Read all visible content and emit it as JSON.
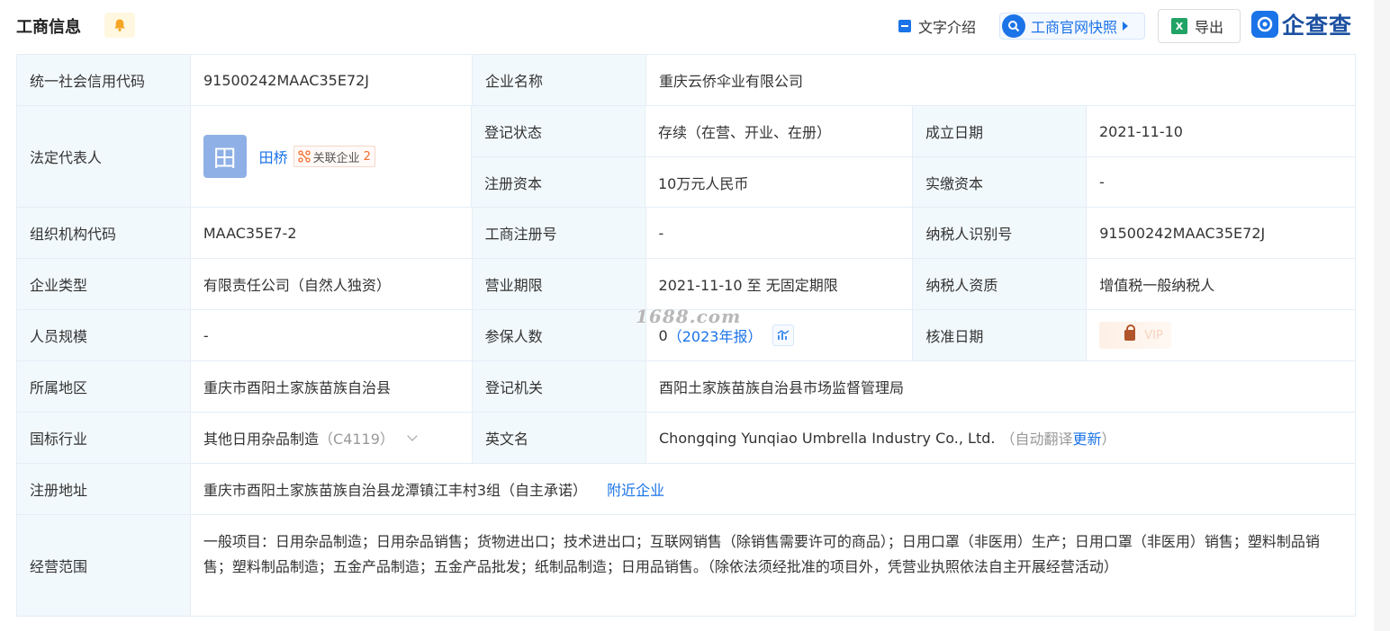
{
  "header": {
    "title": "工商信息",
    "text_intro": "文字介绍",
    "snapshot": "工商官网快照",
    "export": "导出",
    "export_icon_letter": "X",
    "logo_text": "企查查",
    "icons": [
      "bell-icon",
      "doc-icon",
      "search-icon",
      "excel-icon",
      "qcc-logo-icon"
    ]
  },
  "info": {
    "credit_code_label": "统一社会信用代码",
    "credit_code": "91500242MAAC35E72J",
    "company_name_label": "企业名称",
    "company_name": "重庆云侨伞业有限公司",
    "legal_rep_label": "法定代表人",
    "legal_rep_avatar": "田",
    "legal_rep": "田桥",
    "related_label": "关联企业",
    "related_count": "2",
    "status_label": "登记状态",
    "status": "存续（在营、开业、在册）",
    "est_date_label": "成立日期",
    "est_date": "2021-11-10",
    "reg_capital_label": "注册资本",
    "reg_capital": "10万元人民币",
    "paid_capital_label": "实缴资本",
    "paid_capital": "-",
    "org_code_label": "组织机构代码",
    "org_code": "MAAC35E7-2",
    "reg_no_label": "工商注册号",
    "reg_no": "-",
    "taxpayer_id_label": "纳税人识别号",
    "taxpayer_id": "91500242MAAC35E72J",
    "type_label": "企业类型",
    "type": "有限责任公司（自然人独资）",
    "term_label": "营业期限",
    "term": "2021-11-10 至 无固定期限",
    "tax_qual_label": "纳税人资质",
    "tax_qual": "增值税一般纳税人",
    "staff_label": "人员规模",
    "staff": "-",
    "insured_label": "参保人数",
    "insured": "0",
    "insured_year": "（2023年报）",
    "approve_date_label": "核准日期",
    "approve_lock_text": "VIP",
    "region_label": "所属地区",
    "region": "重庆市酉阳土家族苗族自治县",
    "authority_label": "登记机关",
    "authority": "酉阳土家族苗族自治县市场监督管理局",
    "industry_label": "国标行业",
    "industry": "其他日用杂品制造",
    "industry_code": "（C4119）",
    "en_name_label": "英文名",
    "en_name": "Chongqing Yunqiao Umbrella Industry Co., Ltd.",
    "en_auto_prefix": "（自动翻译",
    "en_update": "更新",
    "en_auto_suffix": "）",
    "address_label": "注册地址",
    "address": "重庆市酉阳土家族苗族自治县龙潭镇江丰村3组（自主承诺）",
    "nearby": "附近企业",
    "scope_label": "经营范围",
    "scope": "一般项目：日用杂品制造；日用杂品销售；货物进出口；技术进出口；互联网销售（除销售需要许可的商品）；日用口罩（非医用）生产；日用口罩（非医用）销售；塑料制品销售；塑料制品制造；五金产品制造；五金产品批发；纸制品制造；日用品销售。（除依法须经批准的项目外，凭营业执照依法自主开展经营活动）"
  },
  "watermark": "1688.com",
  "colors": {
    "accent": "#1b73e8",
    "label_bg": "#f2f9fc",
    "border": "#e4eef6",
    "related_count": "#f26b2d"
  }
}
